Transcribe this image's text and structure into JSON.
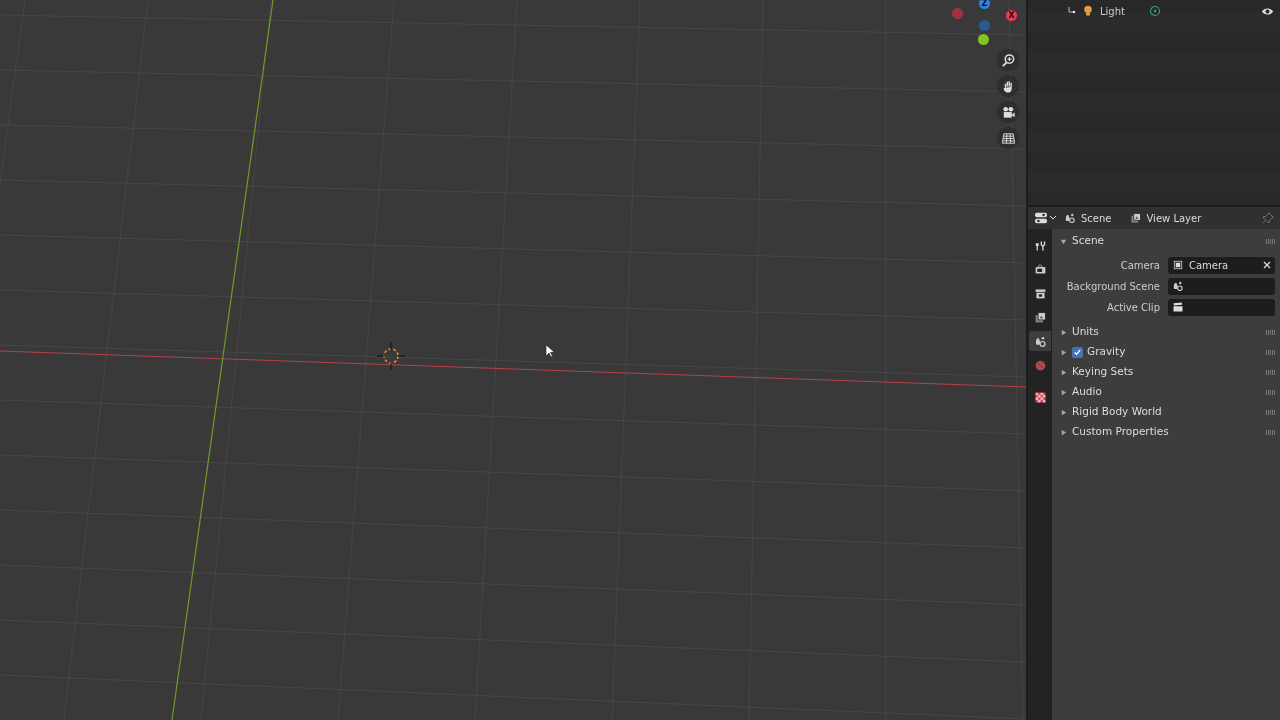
{
  "viewport": {
    "gizmo": [
      {
        "label": "Z",
        "color": "#2f83e3"
      },
      {
        "label": "X",
        "color": "#f5364f"
      },
      {
        "color": "#a3303f"
      },
      {
        "color": "#2a5a92"
      },
      {
        "color": "#84c51b"
      }
    ],
    "nav_buttons": [
      {
        "kind": "zoom"
      },
      {
        "kind": "pan"
      },
      {
        "kind": "camera"
      },
      {
        "kind": "ortho"
      }
    ]
  },
  "outliner": {
    "rows": [
      {
        "name": "Light",
        "visible": true
      }
    ]
  },
  "properties": {
    "header": {
      "items": [
        {
          "label": "Scene",
          "kind": "scene"
        },
        {
          "label": "View Layer",
          "kind": "viewlayer"
        }
      ]
    },
    "side_tabs": [
      {
        "kind": "tool",
        "selected": false
      },
      {
        "kind": "render",
        "selected": false
      },
      {
        "kind": "output",
        "selected": false
      },
      {
        "kind": "viewlayer",
        "selected": false
      },
      {
        "kind": "scene",
        "selected": true
      },
      {
        "kind": "world",
        "selected": false
      },
      {
        "kind": "texture",
        "selected": false
      }
    ],
    "panels": [
      {
        "title": "Scene",
        "expanded": true,
        "kind": "plain",
        "fields": [
          {
            "label": "Camera",
            "kind": "camera",
            "value": "Camera",
            "clearable": true
          },
          {
            "label": "Background Scene",
            "kind": "scene",
            "clearable": false
          },
          {
            "label": "Active Clip",
            "kind": "clip",
            "clearable": false
          }
        ]
      },
      {
        "title": "Units",
        "expanded": false,
        "kind": "plain"
      },
      {
        "title": "Gravity",
        "expanded": false,
        "kind": "toggle",
        "checked": true
      },
      {
        "title": "Keying Sets",
        "expanded": false,
        "kind": "plain"
      },
      {
        "title": "Audio",
        "expanded": false,
        "kind": "plain"
      },
      {
        "title": "Rigid Body World",
        "expanded": false,
        "kind": "plain"
      },
      {
        "title": "Custom Properties",
        "expanded": false,
        "kind": "plain"
      }
    ]
  }
}
